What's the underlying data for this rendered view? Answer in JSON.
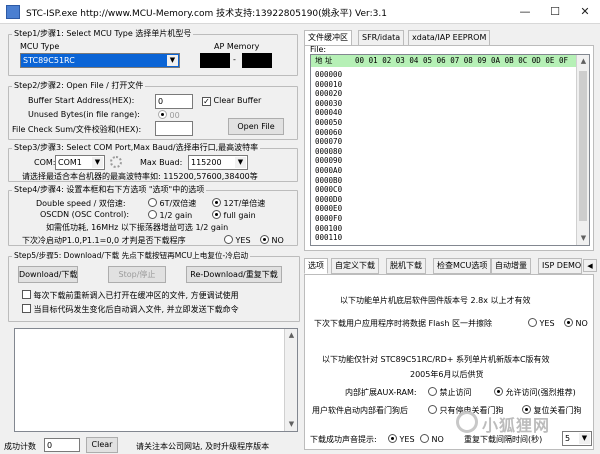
{
  "window": {
    "title": "STC-ISP.exe http://www.MCU-Memory.com 技术支持:13922805190(姚永平) Ver:3.1",
    "minimize": "—",
    "maximize": "☐",
    "close": "✕"
  },
  "step1": {
    "title": "Step1/步骤1: Select MCU Type  选择单片机型号",
    "mcu_label": "MCU Type",
    "ap_label": "AP Memory",
    "mcu_value": "STC89C51RC",
    "ap_sep": "-"
  },
  "step2": {
    "title": "Step2/步骤2: Open File / 打开文件",
    "buffer_label": "Buffer Start Address(HEX):",
    "buffer_value": "0",
    "clear_buffer": "Clear Buffer",
    "unused_label": "Unused Bytes(in file range):",
    "unused_option": "00",
    "checksum_label": "File Check Sum/文件校验和(HEX):",
    "open_file": "Open File"
  },
  "step3": {
    "title": "Step3/步骤3: Select COM Port,Max Baud/选择串行口,最高波特率",
    "com_label": "COM:",
    "com_value": "COM1",
    "maxbaud_label": "Max Buad:",
    "maxbaud_value": "115200",
    "hint": "请选择最适合本台机器的最高波特率如: 115200,57600,38400等"
  },
  "step4": {
    "title": "Step4/步骤4: 设置本框和右下方选项 \"选项\"中的选项",
    "speed_label": "Double speed / 双倍速:",
    "speed_opt1": "6T/双倍速",
    "speed_opt2": "12T/单倍速",
    "oscdn_label": "OSCDN (OSC Control):",
    "oscdn_opt1": "1/2 gain",
    "oscdn_opt2": "full gain",
    "note": "如需低功耗, 16MHz 以下振荡器增益可选 1/2 gain",
    "p1_label": "下次冷启动P1.0,P1.1=0,0 才判是否下载程序",
    "yes": "YES",
    "no": "NO"
  },
  "step5": {
    "title": "Step5/步骤5: Download/下载  先点下载按钮再MCU上电复位-冷启动",
    "download": "Download/下载",
    "stop": "Stop/停止",
    "redownload": "Re-Download/重复下载",
    "check1": "每次下载前重新调入已打开在缓冲区的文件, 方便调试使用",
    "check2": "当目标代码发生变化后自动调入文件, 并立即发送下载命令"
  },
  "status": {
    "count_label": "成功计数",
    "count_value": "0",
    "clear": "Clear",
    "notice": "请关注本公司网站, 及时升级程序版本"
  },
  "buffer_panel": {
    "tabs": [
      "文件缓冲区",
      "SFR/idata",
      "xdata/IAP EEPROM"
    ],
    "file_label": "File:",
    "addr_header": "地 址",
    "col_headers": [
      "00",
      "01",
      "02",
      "03",
      "04",
      "05",
      "06",
      "07",
      "08",
      "09",
      "0A",
      "0B",
      "0C",
      "0D",
      "0E",
      "0F"
    ],
    "rows": [
      "000000",
      "000010",
      "000020",
      "000030",
      "000040",
      "000050",
      "000060",
      "000070",
      "000080",
      "000090",
      "0000A0",
      "0000B0",
      "0000C0",
      "0000D0",
      "0000E0",
      "0000F0",
      "000100",
      "000110"
    ]
  },
  "options_panel": {
    "tabs": [
      "选项",
      "自定义下载",
      "脱机下载",
      "检查MCU选项",
      "自动增量",
      "ISP DEMO"
    ],
    "firmware_note": "以下功能单片机底层软件固件版本号 2.8x 以上才有效",
    "erase_label": "下次下载用户应用程序时将数据 Flash 区一并擦除",
    "yes": "YES",
    "no": "NO",
    "support_note": "以下功能仅针对 STC89C51RC/RD+ 系列单片机新版本C版有效",
    "date_note": "2005年6月以后供货",
    "auxram_label": "内部扩展AUX-RAM:",
    "auxram_opt1": "禁止访问",
    "auxram_opt2": "允许访问(强烈推荐)",
    "watchdog_label": "用户软件启动内部看门狗后",
    "watchdog_opt1": "只有停电关看门狗",
    "watchdog_opt2": "复位关看门狗",
    "beep_label": "下载成功声音提示:",
    "beep_yes": "YES",
    "beep_no": "NO",
    "retry_label": "重复下载间隔时间(秒)",
    "retry_value": "5"
  },
  "watermark": "小狐狸网"
}
